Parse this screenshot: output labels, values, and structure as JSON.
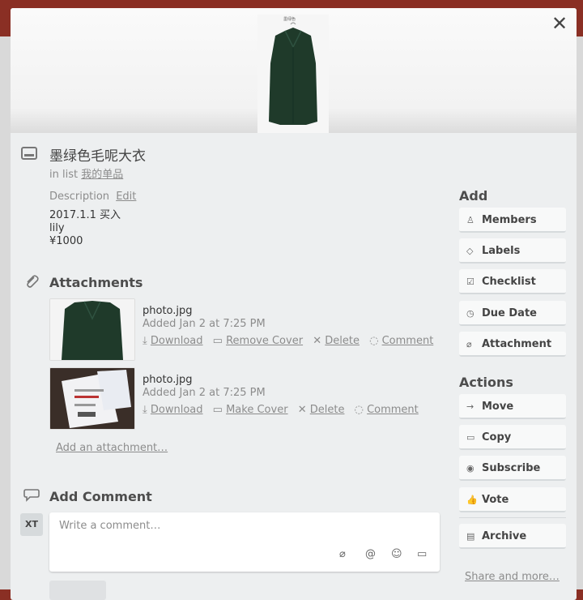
{
  "card": {
    "title": "墨绿色毛呢大衣",
    "in_list_prefix": "in list",
    "list_name": "我的单品",
    "cover_caption": "墨绿色"
  },
  "description": {
    "label": "Description",
    "edit_label": "Edit",
    "lines": [
      "2017.1.1 买入",
      "lily",
      "¥1000"
    ]
  },
  "attachments": {
    "heading": "Attachments",
    "items": [
      {
        "name": "photo.jpg",
        "added": "Added Jan 2 at 7:25 PM",
        "download": "Download",
        "cover_action": "Remove Cover",
        "delete": "Delete",
        "comment": "Comment"
      },
      {
        "name": "photo.jpg",
        "added": "Added Jan 2 at 7:25 PM",
        "download": "Download",
        "cover_action": "Make Cover",
        "delete": "Delete",
        "comment": "Comment"
      }
    ],
    "add_label": "Add an attachment…"
  },
  "comment": {
    "heading": "Add Comment",
    "avatar_initials": "XT",
    "placeholder": "Write a comment…"
  },
  "sidebar": {
    "add_heading": "Add",
    "add_buttons": [
      "Members",
      "Labels",
      "Checklist",
      "Due Date",
      "Attachment"
    ],
    "actions_heading": "Actions",
    "action_buttons": [
      "Move",
      "Copy",
      "Subscribe",
      "Vote",
      "Archive"
    ],
    "share_label": "Share and more…"
  },
  "colors": {
    "background": "#8a2f24",
    "modal": "#edeff0",
    "coat": "#1f3a2a"
  },
  "icons": {
    "close": "close-icon",
    "card": "card-icon",
    "paperclip": "paperclip-icon",
    "comment": "comment-icon"
  }
}
